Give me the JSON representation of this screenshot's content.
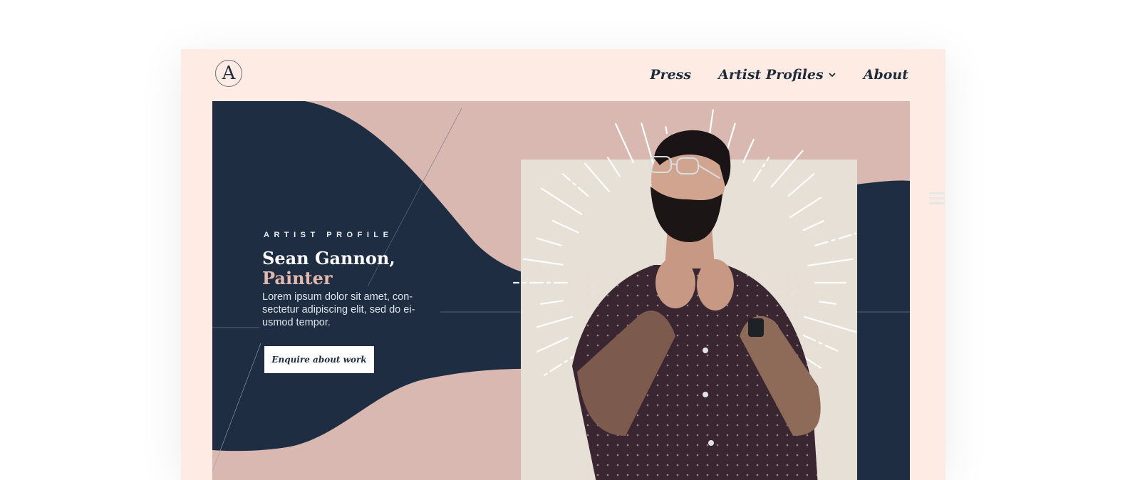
{
  "header": {
    "logo_letter": "A",
    "nav": [
      {
        "label": "Press"
      },
      {
        "label": "Artist Profiles",
        "has_dropdown": true
      },
      {
        "label": "About"
      }
    ]
  },
  "hero": {
    "eyebrow": "ARTIST PROFILE",
    "name_line1": "Sean Gannon,",
    "name_line2": "Painter",
    "description": "Lorem ipsum dolor sit amet, con-sectetur adipiscing elit, sed do ei-usmod tempor.",
    "cta_label": "Enquire about work",
    "portrait_icon": "artist-portrait-photo"
  },
  "colors": {
    "background": "#fdebe4",
    "navy": "#1e2d42",
    "blush": "#d8b8b0",
    "cream": "#e7e0d6",
    "accent_text": "#e3b9ae"
  }
}
